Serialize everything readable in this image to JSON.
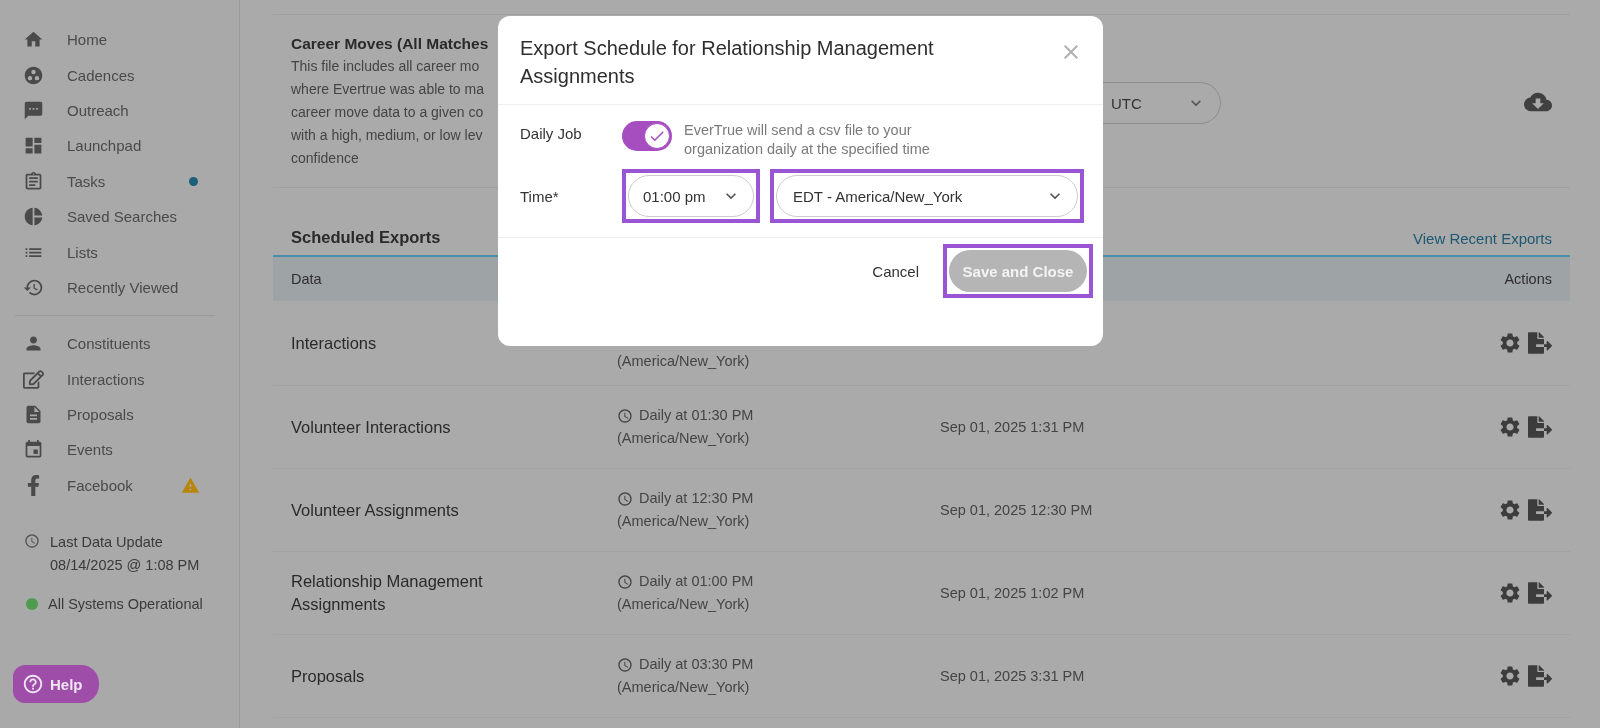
{
  "sidebar": {
    "primary_items": [
      {
        "label": "Home",
        "kind": "plain"
      },
      {
        "label": "Cadences",
        "kind": "plain"
      },
      {
        "label": "Outreach",
        "kind": "plain"
      },
      {
        "label": "Launchpad",
        "kind": "plain"
      },
      {
        "label": "Tasks",
        "kind": "dot",
        "color": "#1b5f78"
      },
      {
        "label": "Saved Searches",
        "kind": "plain"
      },
      {
        "label": "Lists",
        "kind": "plain"
      },
      {
        "label": "Recently Viewed",
        "kind": "plain"
      }
    ],
    "secondary_items": [
      {
        "label": "Constituents",
        "kind": "plain"
      },
      {
        "label": "Interactions",
        "kind": "plain"
      },
      {
        "label": "Proposals",
        "kind": "plain"
      },
      {
        "label": "Events",
        "kind": "plain"
      },
      {
        "label": "Facebook",
        "kind": "warning",
        "color": "#b8860b"
      }
    ],
    "last_update": {
      "label": "Last Data Update",
      "value": "08/14/2025 @ 1:08 PM"
    },
    "system_status": {
      "label": "All Systems Operational",
      "color": "#4f9a4f"
    },
    "help_button": "Help"
  },
  "career_moves": {
    "title": "Career Moves (All Matches",
    "description_lines": [
      "This file includes all career mo",
      "where Evertrue was able to ma",
      "career move data to a given co",
      "with a high, medium, or low lev",
      "confidence"
    ],
    "select_value": "UTC"
  },
  "scheduled_exports": {
    "title": "Scheduled Exports",
    "link": "View Recent Exports",
    "columns": [
      "Data",
      "Actions"
    ],
    "rows": [
      {
        "name": "Interactions",
        "schedule_time": null,
        "schedule_zone": "(America/New_York)",
        "last_run": null
      },
      {
        "name": "Volunteer Interactions",
        "schedule_time": "Daily at 01:30 PM",
        "schedule_zone": "(America/New_York)",
        "last_run": "Sep 01, 2025 1:31 PM"
      },
      {
        "name": "Volunteer Assignments",
        "schedule_time": "Daily at 12:30 PM",
        "schedule_zone": "(America/New_York)",
        "last_run": "Sep 01, 2025 12:30 PM"
      },
      {
        "name": "Relationship Management Assignments",
        "schedule_time": "Daily at 01:00 PM",
        "schedule_zone": "(America/New_York)",
        "last_run": "Sep 01, 2025 1:02 PM"
      },
      {
        "name": "Proposals",
        "schedule_time": "Daily at 03:30 PM",
        "schedule_zone": "(America/New_York)",
        "last_run": "Sep 01, 2025 3:31 PM"
      }
    ]
  },
  "dialog": {
    "title": "Export Schedule for Relationship Management Assignments",
    "daily_job": {
      "label": "Daily Job",
      "on": true,
      "description": "EverTrue will send a csv file to your organization daily at the specified time"
    },
    "time": {
      "label": "Time*",
      "time_value": "01:00 pm",
      "time_highlighted": true,
      "zone_value": "EDT - America/New_York",
      "zone_highlighted": true
    },
    "cancel_button": "Cancel",
    "save_button": {
      "label": "Save and Close",
      "disabled": true,
      "highlighted": true
    }
  }
}
